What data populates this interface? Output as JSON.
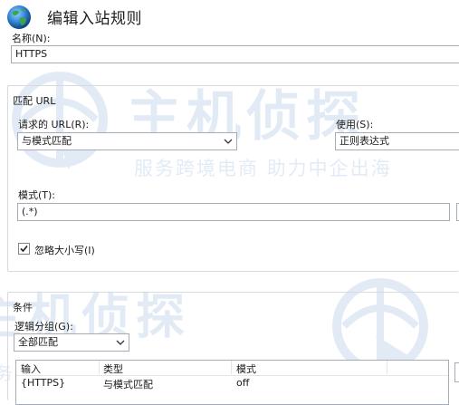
{
  "window": {
    "title": "编辑入站规则"
  },
  "name_field": {
    "label": "名称(N):",
    "value": "HTTPS"
  },
  "match_url": {
    "group_label": "匹配 URL",
    "requested_url_label": "请求的 URL(R):",
    "requested_url_value": "与模式匹配",
    "using_label": "使用(S):",
    "using_value": "正则表达式",
    "pattern_label": "模式(T):",
    "pattern_value": "(.*)",
    "ignore_case_label": "忽略大小写(I)",
    "ignore_case_checked": true
  },
  "conditions": {
    "group_label": "条件",
    "logical_grouping_label": "逻辑分组(G):",
    "logical_grouping_value": "全部匹配",
    "table": {
      "columns": [
        "输入",
        "类型",
        "模式"
      ],
      "rows": [
        [
          "{HTTPS}",
          "与模式匹配",
          "off"
        ]
      ]
    }
  },
  "watermark": {
    "brand": "主机侦探",
    "slogan": "服务跨境电商 助力中企出海"
  },
  "colors": {
    "border": "#a5acb5",
    "group_border": "#d6dbe1",
    "watermark": "#2a6fb7"
  }
}
